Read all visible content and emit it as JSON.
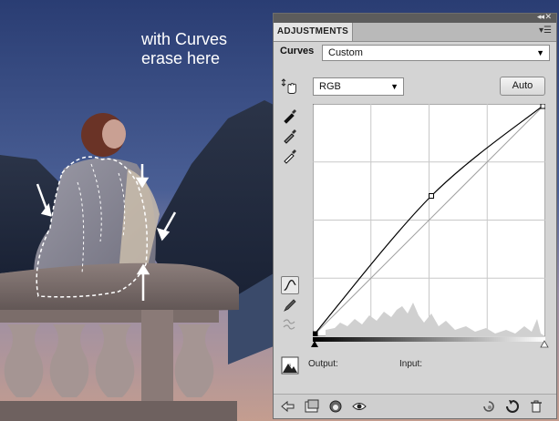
{
  "caption": {
    "line1": "with Curves",
    "line2": "erase here"
  },
  "panel": {
    "tab_title": "ADJUSTMENTS",
    "curves_label": "Curves",
    "preset_value": "Custom",
    "channel_value": "RGB",
    "auto_label": "Auto",
    "output_label": "Output:",
    "input_label": "Input:"
  },
  "curve": {
    "points": [
      [
        0,
        0
      ],
      [
        130,
        154
      ],
      [
        255,
        255
      ]
    ]
  },
  "icons": {
    "collapse": "double-arrow-collapse-icon",
    "panel_menu": "panel-menu-icon",
    "target_adjust": "targeted-adjustment-hand-icon",
    "eyedropper_black": "black-point-eyedropper-icon",
    "eyedropper_gray": "gray-point-eyedropper-icon",
    "eyedropper_white": "white-point-eyedropper-icon",
    "curve_tool": "curve-edit-points-icon",
    "pencil_tool": "pencil-draw-icon",
    "smooth_tool": "smooth-curve-icon",
    "clipping": "show-clipping-icon",
    "back": "return-to-list-icon",
    "expand_view": "expanded-view-icon",
    "clip_to_layer": "clip-to-layer-icon",
    "visibility": "visibility-eye-icon",
    "view_previous": "view-previous-state-icon",
    "reset": "reset-icon",
    "delete": "delete-trash-icon"
  }
}
